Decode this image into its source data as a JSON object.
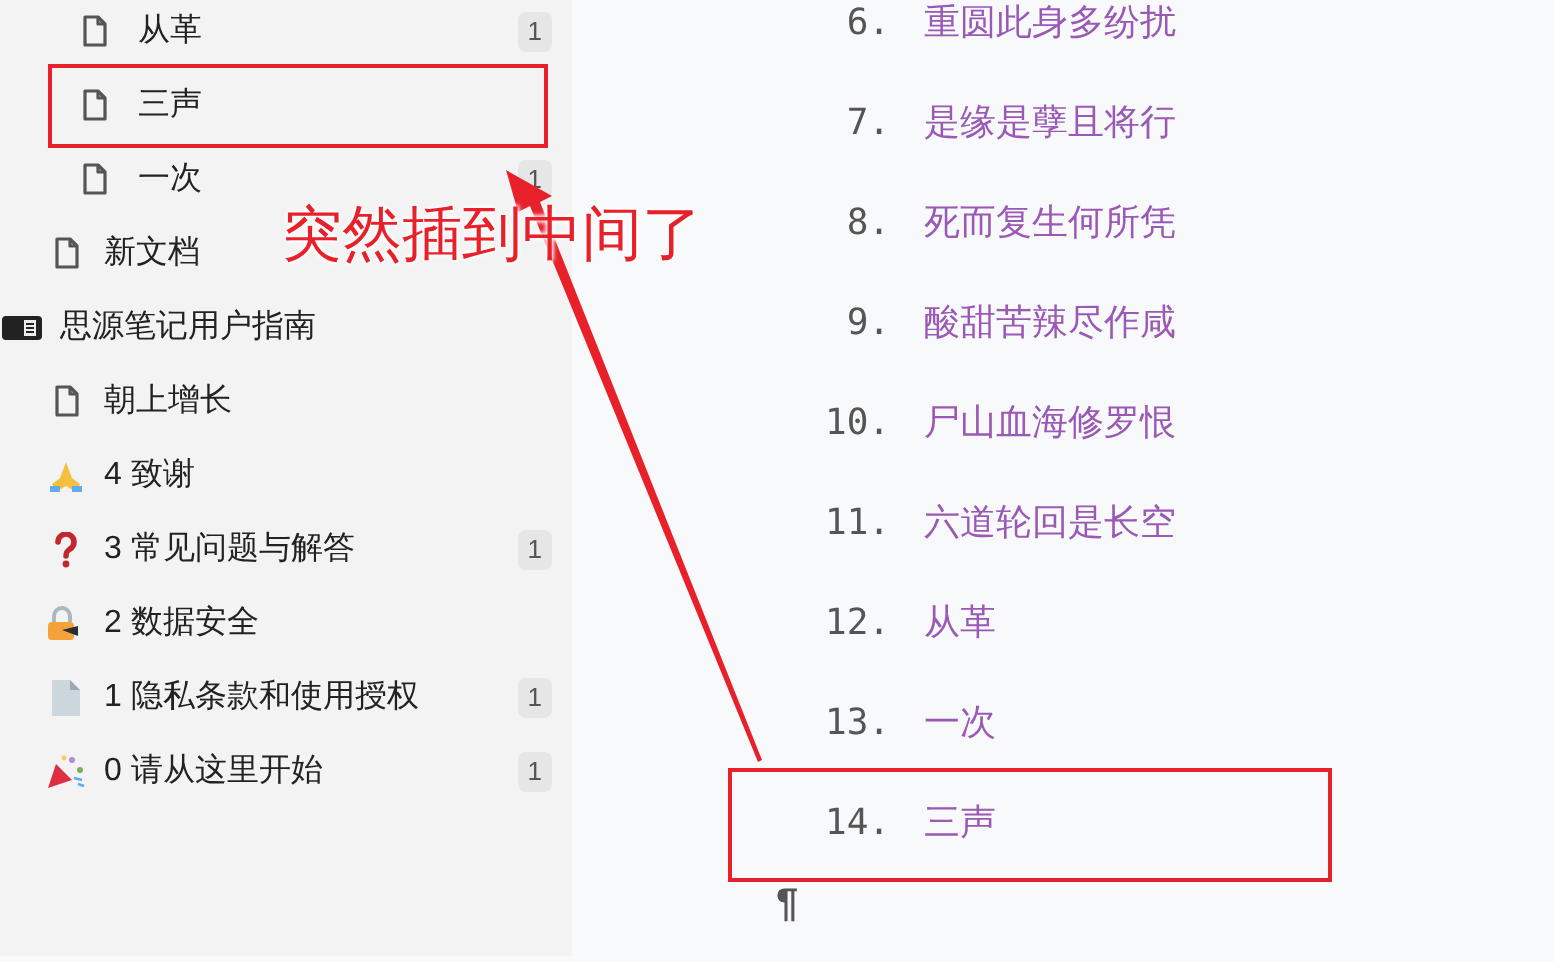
{
  "sidebar": {
    "nested_items": [
      {
        "label": "从革",
        "count": "1",
        "kind": "doc"
      },
      {
        "label": "三声",
        "kind": "doc"
      },
      {
        "label": "一次",
        "count": "1",
        "kind": "doc"
      }
    ],
    "items": [
      {
        "label": "新文档",
        "kind": "doc"
      }
    ],
    "notebooks": [
      {
        "label": "思源笔记用户指南",
        "children": [
          {
            "label": "朝上增长",
            "kind": "doc"
          },
          {
            "label": "4 致谢",
            "kind": "hands"
          },
          {
            "label": "3 常见问题与解答",
            "count": "1",
            "kind": "question"
          },
          {
            "label": "2 数据安全",
            "kind": "lock"
          },
          {
            "label": "1 隐私条款和使用授权",
            "count": "1",
            "kind": "page"
          },
          {
            "label": "0 请从这里开始",
            "count": "1",
            "kind": "party"
          }
        ]
      }
    ]
  },
  "editor": {
    "list": [
      {
        "number": "6.",
        "text": "重圆此身多纷扰"
      },
      {
        "number": "7.",
        "text": "是缘是孽且将行"
      },
      {
        "number": "8.",
        "text": "死而复生何所凭"
      },
      {
        "number": "9.",
        "text": "酸甜苦辣尽作咸"
      },
      {
        "number": "10.",
        "text": "尸山血海修罗恨"
      },
      {
        "number": "11.",
        "text": "六道轮回是长空"
      },
      {
        "number": "12.",
        "text": "从革"
      },
      {
        "number": "13.",
        "text": "一次"
      },
      {
        "number": "14.",
        "text": "三声"
      }
    ],
    "paragraph_mark": "¶"
  },
  "annotation": {
    "label": "突然插到中间了"
  }
}
